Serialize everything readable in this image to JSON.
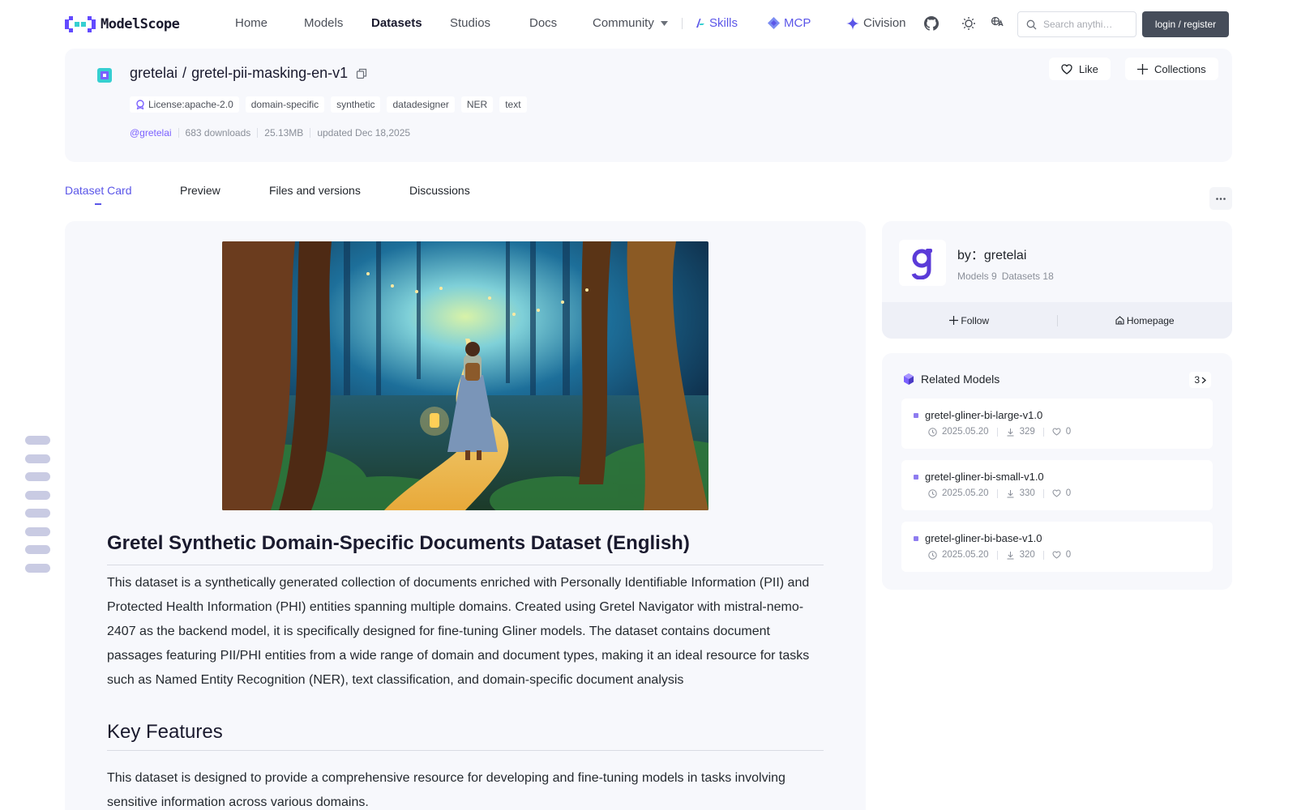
{
  "nav": {
    "logo_text": "ModelScope",
    "items": [
      "Home",
      "Models",
      "Datasets",
      "Studios",
      "Docs",
      "Community"
    ],
    "active": "Datasets",
    "skills": "Skills",
    "mcp": "MCP",
    "civision": "Civision",
    "search_placeholder": "Search anythi…",
    "login": "login / register"
  },
  "dataset": {
    "owner": "gretelai",
    "slash": "/",
    "name": "gretel-pii-masking-en-v1",
    "tags": [
      "License:apache-2.0",
      "domain-specific",
      "synthetic",
      "datadesigner",
      "NER",
      "text"
    ],
    "author": "@gretelai",
    "downloads": "683 downloads",
    "size": "25.13MB",
    "updated": "updated Dec 18,2025",
    "like_label": "Like",
    "collections_label": "Collections"
  },
  "tabs": [
    "Dataset Card",
    "Preview",
    "Files and versions",
    "Discussions"
  ],
  "active_tab": "Dataset Card",
  "card": {
    "title": "Gretel Synthetic Domain-Specific Documents Dataset (English)",
    "intro": "This dataset is a synthetically generated collection of documents enriched with Personally Identifiable Information (PII) and Protected Health Information (PHI) entities spanning multiple domains. Created using Gretel Navigator with mistral-nemo-2407 as the backend model, it is specifically designed for fine-tuning Gliner models. The dataset contains document passages featuring PII/PHI entities from a wide range of domain and document types, making it an ideal resource for tasks such as Named Entity Recognition (NER), text classification, and domain-specific document analysis",
    "section_title": "Key Features",
    "section_text": "This dataset is designed to provide a comprehensive resource for developing and fine-tuning models in tasks involving sensitive information across various domains."
  },
  "org": {
    "by": "by：gretelai",
    "models": "Models 9",
    "datasets": "Datasets 18",
    "follow": "Follow",
    "homepage": "Homepage"
  },
  "related": {
    "title": "Related Models",
    "count": "3",
    "models": [
      {
        "name": "gretel-gliner-bi-large-v1.0",
        "date": "2025.05.20",
        "downloads": "329",
        "likes": "0"
      },
      {
        "name": "gretel-gliner-bi-small-v1.0",
        "date": "2025.05.20",
        "downloads": "330",
        "likes": "0"
      },
      {
        "name": "gretel-gliner-bi-base-v1.0",
        "date": "2025.05.20",
        "downloads": "320",
        "likes": "0"
      }
    ]
  },
  "colors": {
    "accent": "#5b56e8",
    "author": "#7b61ff",
    "login_bg": "#464d5a",
    "card_bg": "#f7f8fc"
  }
}
